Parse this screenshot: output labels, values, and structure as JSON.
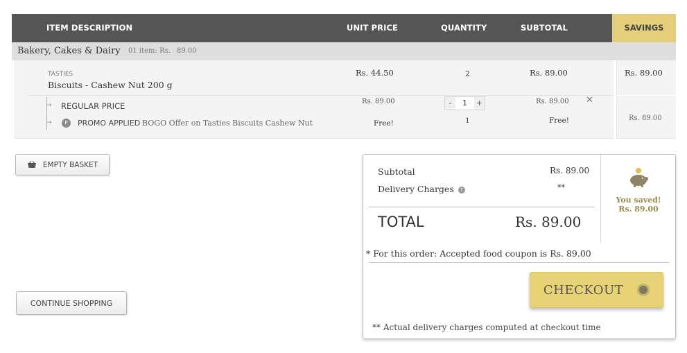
{
  "table_header": {
    "item_description": "ITEM DESCRIPTION",
    "unit_price": "UNIT PRICE",
    "quantity": "QUANTITY",
    "subtotal": "SUBTOTAL",
    "savings": "SAVINGS"
  },
  "category": {
    "name": "Bakery, Cakes & Dairy",
    "count": "01 item: Rs.",
    "total": "89.00"
  },
  "item": {
    "brand": "TASTIES",
    "name": "Biscuits - Cashew Nut 200 g",
    "unit_price": "Rs. 44.50",
    "quantity": "2",
    "subtotal": "Rs. 89.00",
    "savings": "Rs. 89.00",
    "regular": {
      "label": "REGULAR PRICE",
      "unit_price": "Rs. 89.00",
      "stepper_minus": "-",
      "stepper_value": "1",
      "stepper_plus": "+",
      "subtotal": "Rs. 89.00",
      "remove": "✕"
    },
    "promo": {
      "icon": "P",
      "label": "PROMO APPLIED :",
      "text": "BOGO Offer on Tasties Biscuits Cashew Nut",
      "unit_price": "Free!",
      "quantity": "1",
      "subtotal": "Free!",
      "savings": "Rs. 89.00"
    },
    "arrow": "→"
  },
  "buttons": {
    "empty_basket": "EMPTY BASKET",
    "continue_shopping": "CONTINUE SHOPPING",
    "checkout": "CHECKOUT"
  },
  "summary": {
    "subtotal_label": "Subtotal",
    "subtotal_value": "Rs. 89.00",
    "delivery_label": "Delivery Charges",
    "delivery_help": "?",
    "delivery_value": "**",
    "total_label": "TOTAL",
    "total_value": "Rs. 89.00",
    "saved_label": "You saved!",
    "saved_value": "Rs. 89.00",
    "coupon_note": "* For this order: Accepted food coupon is Rs. 89.00",
    "delivery_note": "** Actual delivery charges computed at checkout time"
  },
  "colors": {
    "header_bg": "#555555",
    "savings_bg": "#e6cf7a",
    "checkout_bg": "#e8d276"
  },
  "icons": {
    "basket": "basket-icon",
    "piggy_bank": "piggy-bank-icon",
    "promo": "promo-icon",
    "help": "help-icon",
    "remove": "close-icon",
    "checkout": "circle-arrow-icon"
  }
}
